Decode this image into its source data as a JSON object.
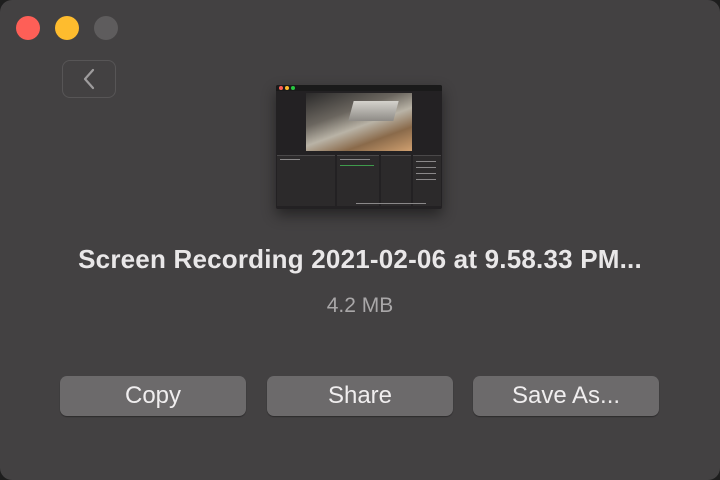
{
  "window": {
    "controls": [
      "close",
      "minimize",
      "zoom"
    ]
  },
  "nav": {
    "back_icon": "chevron-left-icon"
  },
  "file": {
    "name": "Screen Recording 2021-02-06 at 9.58.33 PM...",
    "size": "4.2 MB"
  },
  "actions": {
    "copy_label": "Copy",
    "share_label": "Share",
    "save_label": "Save As..."
  },
  "colors": {
    "window_bg": "#434142",
    "button_bg": "#6c6a6b",
    "close": "#fe5f57",
    "minimize": "#febc2e",
    "zoom_inactive": "#5e5c5d"
  }
}
